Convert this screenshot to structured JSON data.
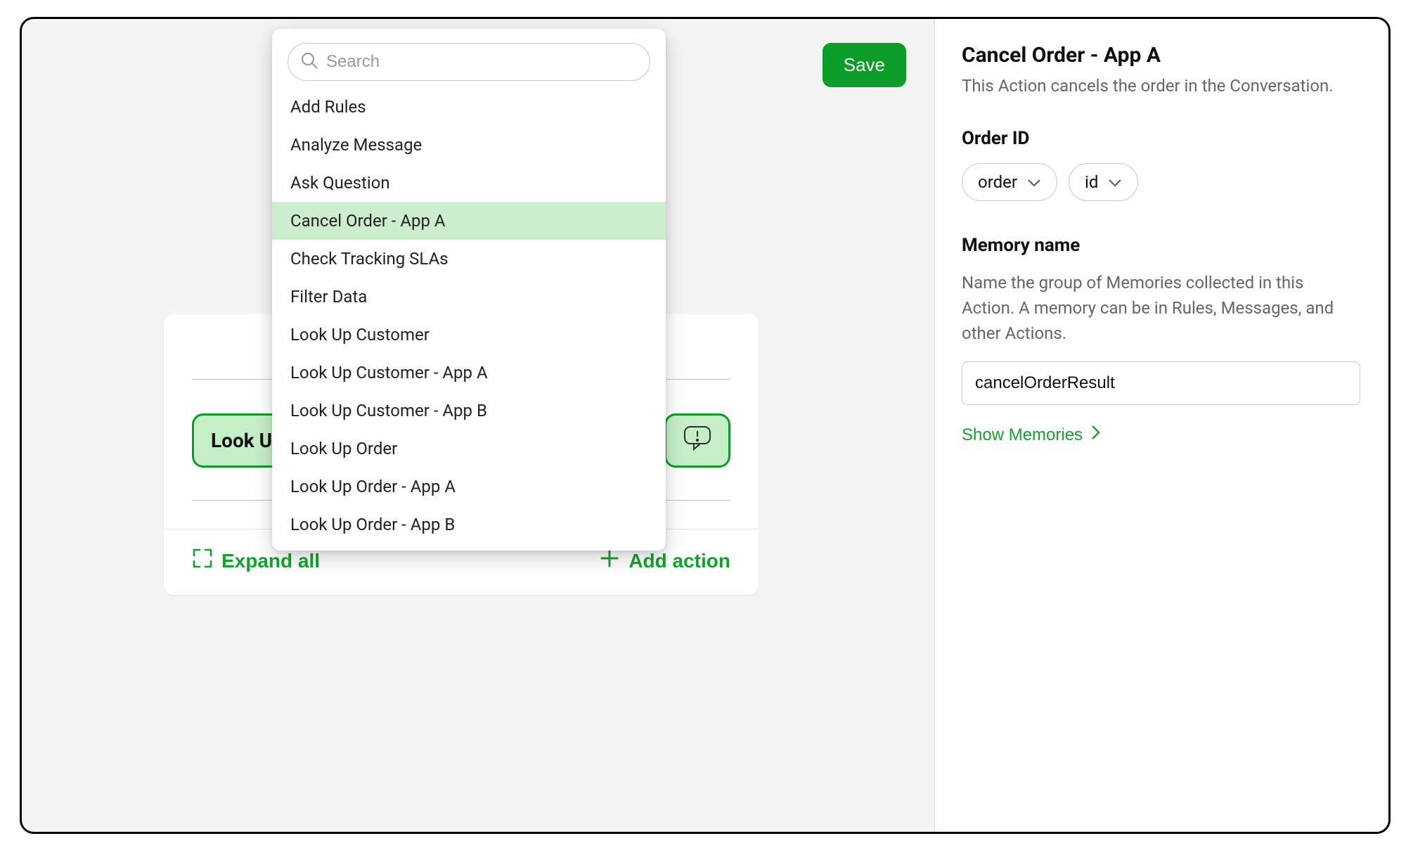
{
  "toolbar": {
    "save_label": "Save"
  },
  "dropdown": {
    "search_placeholder": "Search",
    "items": [
      {
        "label": "Add Rules",
        "selected": false
      },
      {
        "label": "Analyze Message",
        "selected": false
      },
      {
        "label": "Ask Question",
        "selected": false
      },
      {
        "label": "Cancel Order - App A",
        "selected": true
      },
      {
        "label": "Check Tracking SLAs",
        "selected": false
      },
      {
        "label": "Filter Data",
        "selected": false
      },
      {
        "label": "Look Up Customer",
        "selected": false
      },
      {
        "label": "Look Up Customer - App A",
        "selected": false
      },
      {
        "label": "Look Up Customer - App B",
        "selected": false
      },
      {
        "label": "Look Up Order",
        "selected": false
      },
      {
        "label": "Look Up Order - App A",
        "selected": false
      },
      {
        "label": "Look Up Order - App B",
        "selected": false
      }
    ]
  },
  "card": {
    "chip_label": "Look Up",
    "expand_all_label": "Expand all",
    "add_action_label": "Add action"
  },
  "details": {
    "title": "Cancel Order - App A",
    "description": "This Action cancels the order in the Conversation.",
    "order_id_label": "Order ID",
    "order_pill_1": "order",
    "order_pill_2": "id",
    "memory_name_label": "Memory name",
    "memory_help": "Name the group of Memories collected in this Action. A memory can be in Rules, Messages, and other Actions.",
    "memory_value": "cancelOrderResult",
    "show_memories_label": "Show Memories"
  }
}
